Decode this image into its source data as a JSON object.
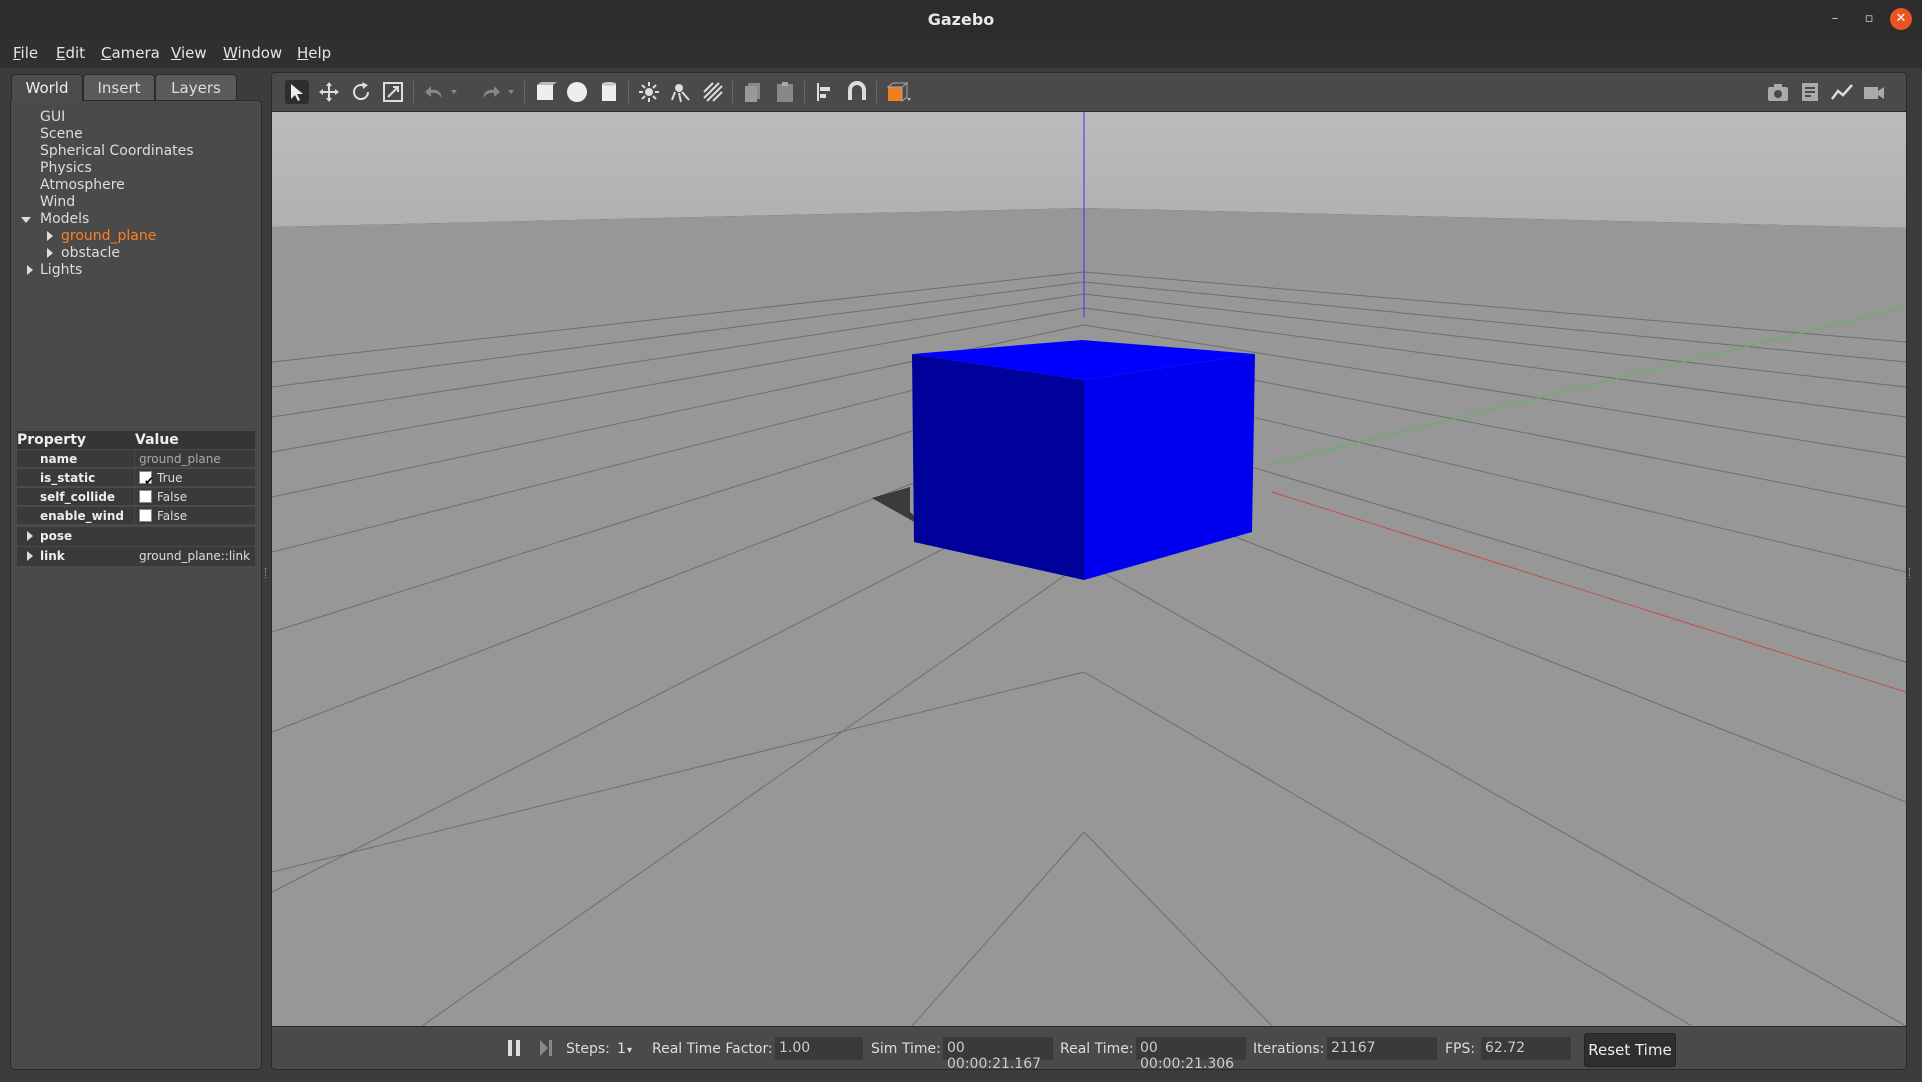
{
  "window": {
    "title": "Gazebo"
  },
  "menu": [
    "File",
    "Edit",
    "Camera",
    "View",
    "Window",
    "Help"
  ],
  "left_panel": {
    "tabs": [
      {
        "label": "World",
        "active": true
      },
      {
        "label": "Insert",
        "active": false
      },
      {
        "label": "Layers",
        "active": false
      }
    ],
    "tree": {
      "items": [
        "GUI",
        "Scene",
        "Spherical Coordinates",
        "Physics",
        "Atmosphere",
        "Wind"
      ],
      "models_label": "Models",
      "models": [
        "ground_plane",
        "obstacle"
      ],
      "selected_model": "ground_plane",
      "lights_label": "Lights"
    },
    "properties": {
      "header_property": "Property",
      "header_value": "Value",
      "rows": [
        {
          "name": "name",
          "value": "ground_plane",
          "type": "text"
        },
        {
          "name": "is_static",
          "value": "True",
          "type": "checkbox",
          "checked": true
        },
        {
          "name": "self_collide",
          "value": "False",
          "type": "checkbox",
          "checked": false
        },
        {
          "name": "enable_wind",
          "value": "False",
          "type": "checkbox",
          "checked": false
        }
      ],
      "pose_label": "pose",
      "link_label": "link",
      "link_value": "ground_plane::link"
    }
  },
  "toolbar": {
    "icons": [
      "select-mode-icon",
      "translate-mode-icon",
      "rotate-mode-icon",
      "scale-mode-icon",
      "undo-icon",
      "redo-icon",
      "box-icon",
      "sphere-icon",
      "cylinder-icon",
      "point-light-icon",
      "spot-light-icon",
      "directional-light-icon",
      "copy-icon",
      "paste-icon",
      "align-icon",
      "snap-icon",
      "view-angle-icon"
    ],
    "right_icons": [
      "screenshot-icon",
      "log-icon",
      "plot-icon",
      "record-video-icon"
    ]
  },
  "colors": {
    "box": "#0000ff",
    "selection": "#ff7f20",
    "x_axis": "#d04040",
    "y_axis": "#40c040",
    "z_axis": "#3030ff"
  },
  "status": {
    "steps_label": "Steps:",
    "steps_value": "1",
    "rtf_label": "Real Time Factor:",
    "rtf_value": "1.00",
    "sim_time_label": "Sim Time:",
    "sim_time_value": "00 00:00:21.167",
    "real_time_label": "Real Time:",
    "real_time_value": "00 00:00:21.306",
    "iterations_label": "Iterations:",
    "iterations_value": "21167",
    "fps_label": "FPS:",
    "fps_value": "62.72",
    "reset_label": "Reset Time"
  }
}
